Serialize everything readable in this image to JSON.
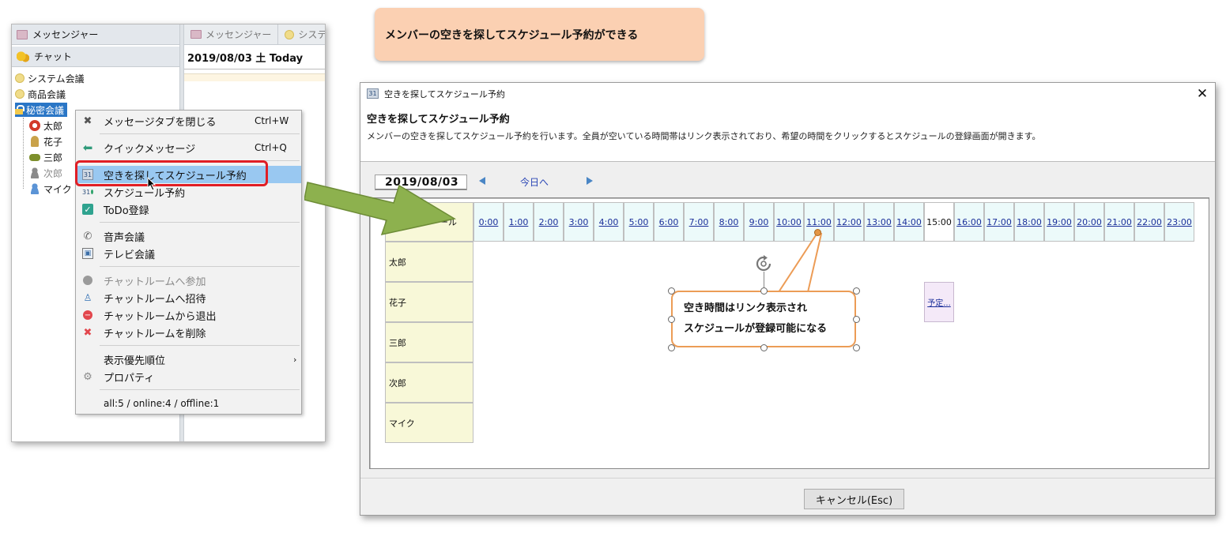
{
  "banner": {
    "text": "メンバーの空きを探してスケジュール予約ができる"
  },
  "messenger": {
    "pane_messenger": "メッセンジャー",
    "pane_chat": "チャット",
    "rooms": [
      {
        "name": "システム会議"
      },
      {
        "name": "商品会議"
      },
      {
        "name": "秘密会議"
      }
    ],
    "members": [
      {
        "name": "太郎",
        "color": "#d23a2a"
      },
      {
        "name": "花子",
        "color": "#c9a24a"
      },
      {
        "name": "三郎",
        "color": "#7d8f2c"
      },
      {
        "name": "次郎",
        "color": "#8a8a8a"
      },
      {
        "name": "マイク",
        "color": "#5b94d6"
      }
    ],
    "tabs": [
      "メッセンジャー",
      "システ"
    ],
    "date_label": "2019/08/03 土 Today"
  },
  "context_menu": {
    "items": [
      {
        "label": "メッセージタブを閉じる",
        "shortcut": "Ctrl+W",
        "icon": "close-x-icon"
      },
      {
        "label": "クイックメッセージ",
        "shortcut": "Ctrl+Q",
        "icon": "reply-arrow-icon"
      },
      {
        "label": "空きを探してスケジュール予約",
        "shortcut": "",
        "icon": "calendar-search-icon"
      },
      {
        "label": "スケジュール予約",
        "shortcut": "",
        "icon": "calendar-add-icon"
      },
      {
        "label": "ToDo登録",
        "shortcut": "",
        "icon": "checkbox-icon"
      },
      {
        "label": "音声会議",
        "shortcut": "",
        "icon": "phone-icon"
      },
      {
        "label": "テレビ会議",
        "shortcut": "",
        "icon": "video-call-icon"
      },
      {
        "label": "チャットルームへ参加",
        "shortcut": "",
        "icon": "join-dot-icon"
      },
      {
        "label": "チャットルームへ招待",
        "shortcut": "",
        "icon": "invite-user-icon"
      },
      {
        "label": "チャットルームから退出",
        "shortcut": "",
        "icon": "leave-icon"
      },
      {
        "label": "チャットルームを削除",
        "shortcut": "",
        "icon": "delete-x-icon"
      },
      {
        "label": "表示優先順位",
        "shortcut": "",
        "icon": "submenu-arrow-icon"
      },
      {
        "label": "プロパティ",
        "shortcut": "",
        "icon": "gears-icon"
      }
    ],
    "stats": "all:5 / online:4 / offline:1"
  },
  "dialog": {
    "window_title": "空きを探してスケジュール予約",
    "heading": "空きを探してスケジュール予約",
    "description": "メンバーの空きを探してスケジュール予約を行います。全員が空いている時間帯はリンク表示されており、希望の時間をクリックするとスケジュールの登録画面が開きます。",
    "date": "2019/08/03",
    "today_button": "今日へ",
    "member_header": "ール",
    "hours": [
      "0:00",
      "1:00",
      "2:00",
      "3:00",
      "4:00",
      "5:00",
      "6:00",
      "7:00",
      "8:00",
      "9:00",
      "10:00",
      "11:00",
      "12:00",
      "13:00",
      "14:00",
      "15:00",
      "16:00",
      "17:00",
      "18:00",
      "19:00",
      "20:00",
      "21:00",
      "22:00",
      "23:00"
    ],
    "unavailable_hour": "15:00",
    "members": [
      "太郎",
      "花子",
      "三郎",
      "次郎",
      "マイク"
    ],
    "booked_slot": {
      "label": "予定...",
      "member": "花子",
      "hour": "15:00"
    },
    "cancel_button": "キャンセル(Esc)"
  },
  "callout": {
    "line1": "空き時間はリンク表示され",
    "line2": "スケジュールが登録可能になる",
    "color": "#ec9c56"
  },
  "colors": {
    "selection_blue": "#2a76c6",
    "menu_highlight": "#99c8f1",
    "red_outline": "#e01e25",
    "arrow_green": "#8db14e",
    "hour_cell_bg": "#ecfafa",
    "member_cell_bg": "#f8f8d8"
  }
}
